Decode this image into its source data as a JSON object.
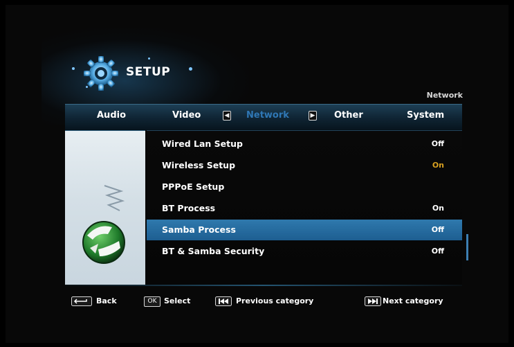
{
  "header": {
    "title": "SETUP",
    "breadcrumb": "Network"
  },
  "tabs": [
    {
      "label": "Audio",
      "active": false
    },
    {
      "label": "Video",
      "active": false
    },
    {
      "label": "Network",
      "active": true
    },
    {
      "label": "Other",
      "active": false
    },
    {
      "label": "System",
      "active": false
    }
  ],
  "nav_arrows": {
    "left": "◀",
    "right": "▶"
  },
  "settings": [
    {
      "label": "Wired Lan Setup",
      "value": "Off",
      "selected": false
    },
    {
      "label": "Wireless Setup",
      "value": "On",
      "selected": false
    },
    {
      "label": "PPPoE Setup",
      "value": "",
      "selected": false
    },
    {
      "label": "BT Process",
      "value": "On",
      "selected": false
    },
    {
      "label": "Samba Process",
      "value": "Off",
      "selected": true
    },
    {
      "label": "BT & Samba Security",
      "value": "Off",
      "selected": false
    }
  ],
  "footer": {
    "back_label": "Back",
    "select_key": "OK",
    "select_label": "Select",
    "prev_label": "Previous category",
    "next_label": "Next category"
  },
  "colors": {
    "active_tab": "#2f77b5",
    "selected_row": "#2f79ad",
    "wireless_on": "#d8a020"
  }
}
